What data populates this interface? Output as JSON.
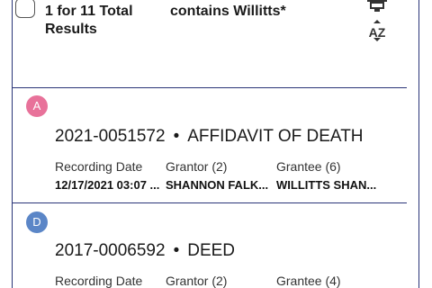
{
  "header": {
    "results_line1": "1 for 11 Total",
    "results_line2": "Results",
    "filter_text": "contains Willitts*",
    "cutoff_text": "ˌ ˌ",
    "filter_icon": "filter-icon",
    "sort_icon": "sort-az-icon",
    "sort_label": "AZ"
  },
  "results": [
    {
      "badge": "A",
      "badge_color": "#e8729a",
      "doc_number": "2021-0051572",
      "separator": "•",
      "doc_type": "AFFIDAVIT OF DEATH",
      "recording_date_label": "Recording Date",
      "recording_date_value": "12/17/2021 03:07 ...",
      "grantor_label": "Grantor (2)",
      "grantor_value": "SHANNON FALK...",
      "grantee_label": "Grantee (6)",
      "grantee_value": "WILLITTS SHAN..."
    },
    {
      "badge": "D",
      "badge_color": "#5b86c7",
      "doc_number": "2017-0006592",
      "separator": "•",
      "doc_type": "DEED",
      "recording_date_label": "Recording Date",
      "grantor_label": "Grantor (2)",
      "grantee_label": "Grantee (4)"
    }
  ]
}
